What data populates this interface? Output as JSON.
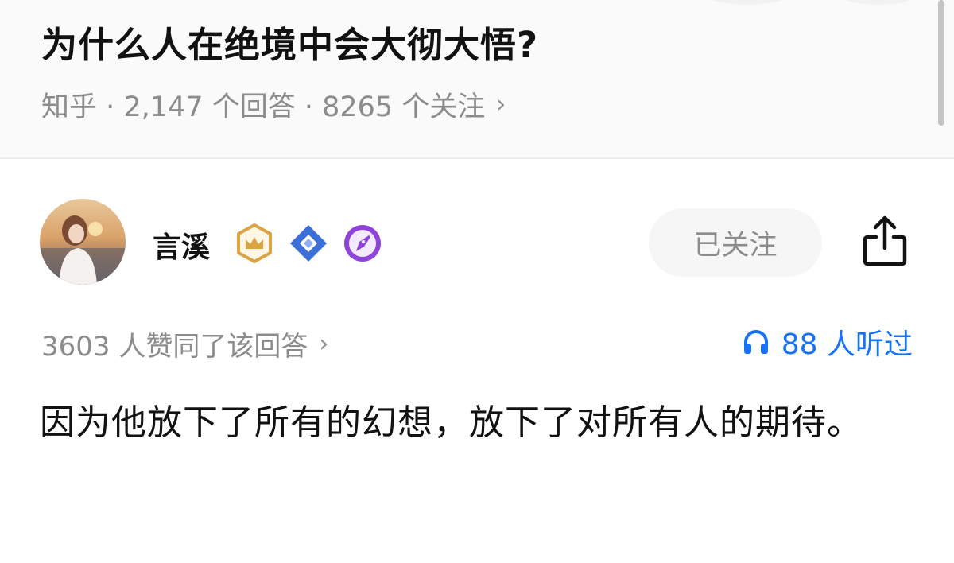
{
  "question": {
    "title": "为什么人在绝境中会大彻大悟?",
    "meta": "知乎 · 2,147 个回答 · 8265 个关注",
    "meta_chevron": "›"
  },
  "author": {
    "name": "言溪",
    "badges": [
      "crown-badge-icon",
      "diamond-badge-icon",
      "pen-badge-icon"
    ],
    "follow_label": "已关注"
  },
  "stats": {
    "votes_text": "3603 人赞同了该回答",
    "votes_chevron": "›",
    "listen_text": "88 人听过"
  },
  "answer": {
    "text": "因为他放下了所有的幻想，放下了对所有人的期待。"
  },
  "colors": {
    "accent_blue": "#1772f6",
    "crown_gold": "#d9a441",
    "diamond_blue": "#3d6fd9",
    "pen_purple": "#8e44d9",
    "muted_text": "#8c8c8c"
  }
}
